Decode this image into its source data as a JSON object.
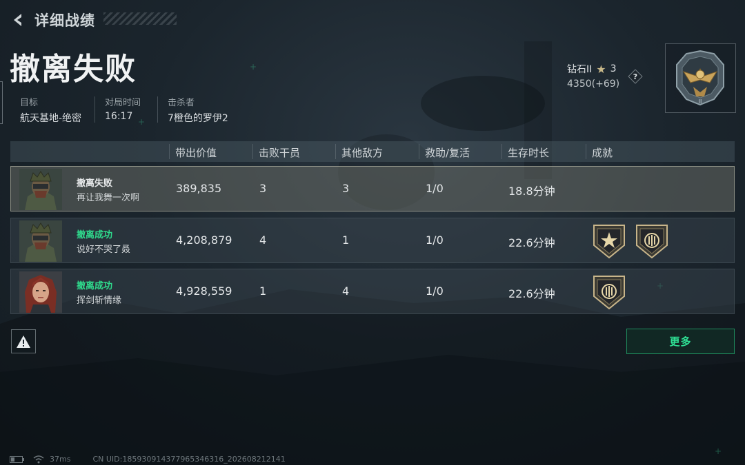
{
  "header": {
    "title": "详细战绩"
  },
  "result": {
    "title": "撤离失败"
  },
  "info": {
    "target_label": "目标",
    "target_value": "航天基地-绝密",
    "time_label": "对局时间",
    "time_value": "16:17",
    "killer_label": "击杀者",
    "killer_value": "7橙色的罗伊2"
  },
  "rank": {
    "name": "钻石II",
    "stars": "3",
    "score": "4350(+69)",
    "help_icon": "question-icon",
    "badge_icon": "eagle-rank-badge-icon"
  },
  "table": {
    "headers": [
      "带出价值",
      "击败干员",
      "其他敌方",
      "救助/复活",
      "生存时长",
      "成就"
    ],
    "rows": [
      {
        "status": "撤离失败",
        "name": "再让我舞一次啊",
        "value": "389,835",
        "kills": "3",
        "others": "3",
        "assists": "1/0",
        "duration": "18.8分钟",
        "avatar": "soldier-avatar",
        "medals": []
      },
      {
        "status": "撤离成功",
        "name": "说好不哭了叒",
        "value": "4,208,879",
        "kills": "4",
        "others": "1",
        "assists": "1/0",
        "duration": "22.6分钟",
        "avatar": "soldier-avatar",
        "medals": [
          "star-medal-icon",
          "emblem-medal-icon"
        ]
      },
      {
        "status": "撤离成功",
        "name": "挥剑斩情缘",
        "value": "4,928,559",
        "kills": "1",
        "others": "4",
        "assists": "1/0",
        "duration": "22.6分钟",
        "avatar": "female-avatar",
        "medals": [
          "emblem-medal-icon"
        ]
      }
    ]
  },
  "buttons": {
    "more": "更多",
    "warning_icon": "warning-icon"
  },
  "statusbar": {
    "ping": "37ms",
    "uid": "CN UID:1859309143779653463​16_202608212141"
  },
  "colors": {
    "success": "#2fd98c",
    "accent_border": "#1f8c5e"
  }
}
